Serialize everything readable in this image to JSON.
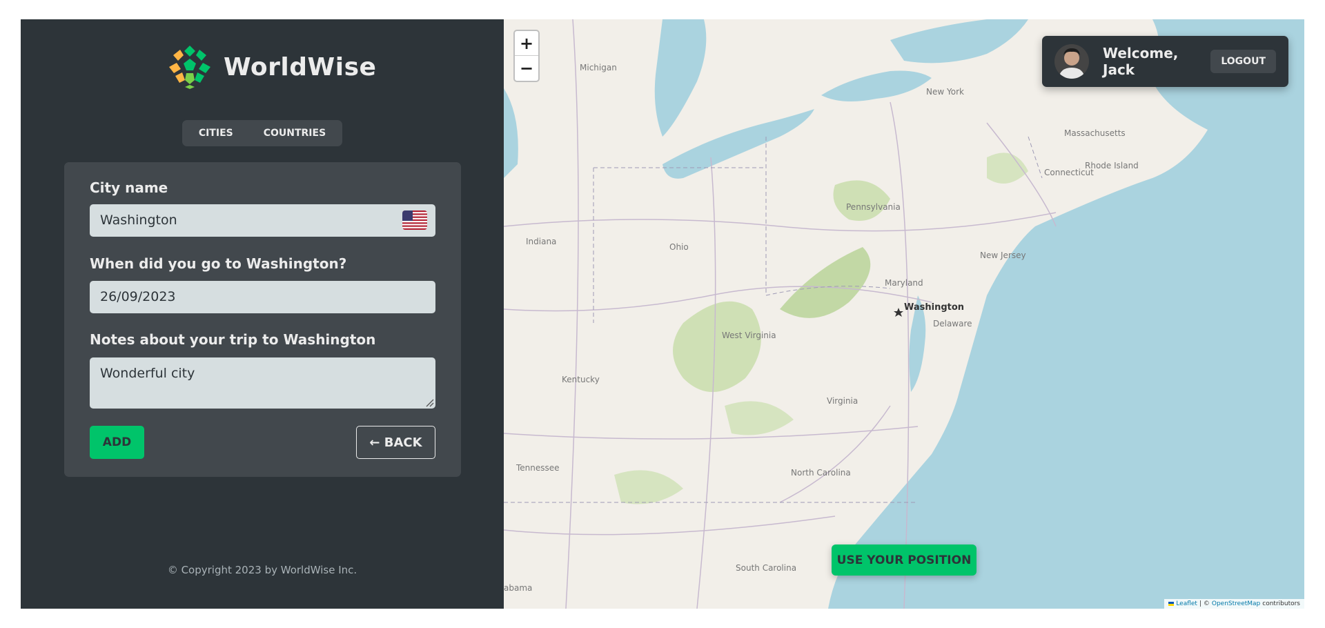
{
  "app": {
    "name": "WorldWise"
  },
  "nav": {
    "tabs": [
      {
        "label": "CITIES"
      },
      {
        "label": "COUNTRIES"
      }
    ]
  },
  "form": {
    "city_label": "City name",
    "city_value": "Washington",
    "date_label": "When did you go to Washington?",
    "date_value": "26/09/2023",
    "notes_label": "Notes about your trip to Washington",
    "notes_value": "Wonderful city",
    "add_label": "ADD",
    "back_label": "← BACK"
  },
  "footer": {
    "copyright": "© Copyright 2023 by WorldWise Inc."
  },
  "map": {
    "zoom_in": "+",
    "zoom_out": "−",
    "use_position": "USE YOUR POSITION",
    "attribution": {
      "leaflet": "Leaflet",
      "sep": "| ©",
      "osm": "OpenStreetMap",
      "rest": "contributors"
    },
    "labels": {
      "michigan": "Michigan",
      "new_york": "New York",
      "massachusetts": "Massachusetts",
      "rhode_island": "Rhode Island",
      "connecticut": "Connecticut",
      "pennsylvania": "Pennsylvania",
      "new_jersey": "New Jersey",
      "indiana": "Indiana",
      "ohio": "Ohio",
      "maryland": "Maryland",
      "washington": "Washington",
      "delaware": "Delaware",
      "west_virginia": "West Virginia",
      "kentucky": "Kentucky",
      "virginia": "Virginia",
      "tennessee": "Tennessee",
      "north_carolina": "North Carolina",
      "south_carolina": "South Carolina",
      "alabama": "abama"
    }
  },
  "user": {
    "welcome": "Welcome, Jack",
    "logout": "LOGOUT"
  },
  "colors": {
    "brand_green": "#00c46a",
    "sidebar_bg": "#2d3439",
    "panel_bg": "#42484d",
    "sea": "#aad3df"
  }
}
